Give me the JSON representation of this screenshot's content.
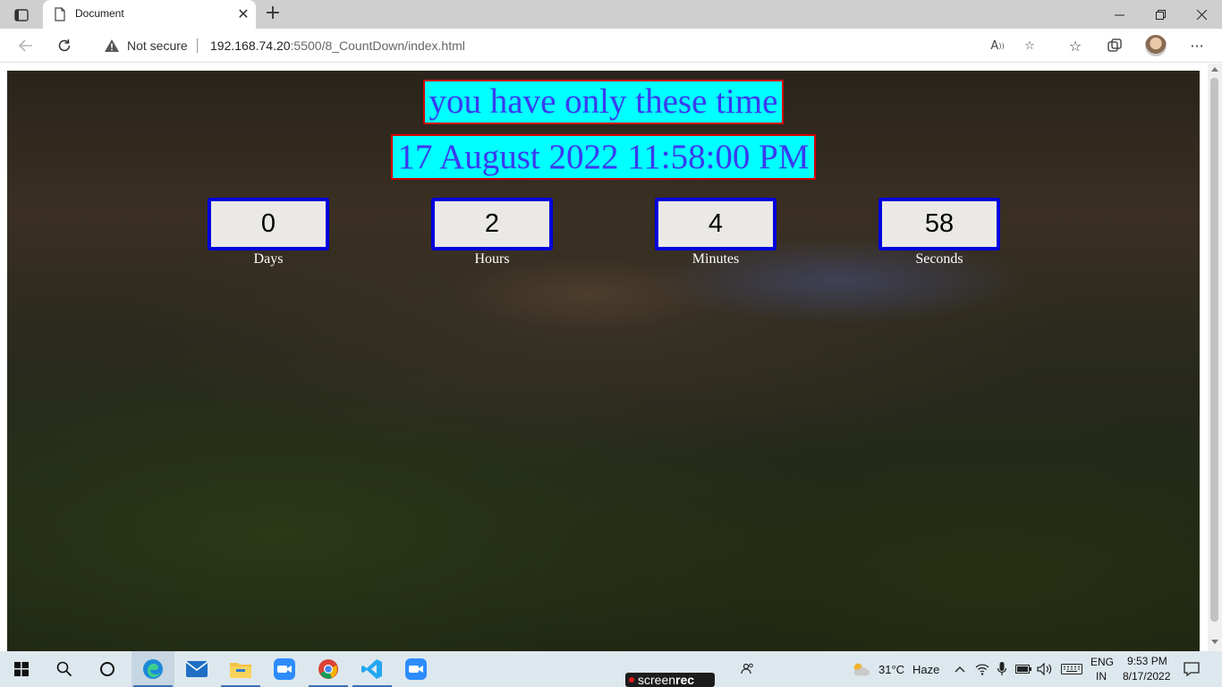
{
  "browser": {
    "tab_title": "Document",
    "address": {
      "security_label": "Not secure",
      "url_host": "192.168.74.20",
      "url_rest": ":5500/8_CountDown/index.html"
    }
  },
  "page": {
    "heading": "you have only these time",
    "target_date": "17 August 2022 11:58:00 PM",
    "countdown": [
      {
        "value": "0",
        "label": "Days"
      },
      {
        "value": "2",
        "label": "Hours"
      },
      {
        "value": "4",
        "label": "Minutes"
      },
      {
        "value": "58",
        "label": "Seconds"
      }
    ]
  },
  "taskbar": {
    "overlay_brand_a": "screen",
    "overlay_brand_b": "rec",
    "weather_temp": "31°C",
    "weather_desc": "Haze",
    "lang_top": "ENG",
    "lang_bottom": "IN",
    "time": "9:53 PM",
    "date": "8/17/2022"
  },
  "colors": {
    "box_border": "#0000dd",
    "title_bg": "#00ffff",
    "title_border": "#d40000",
    "title_text": "#3a3af0"
  }
}
